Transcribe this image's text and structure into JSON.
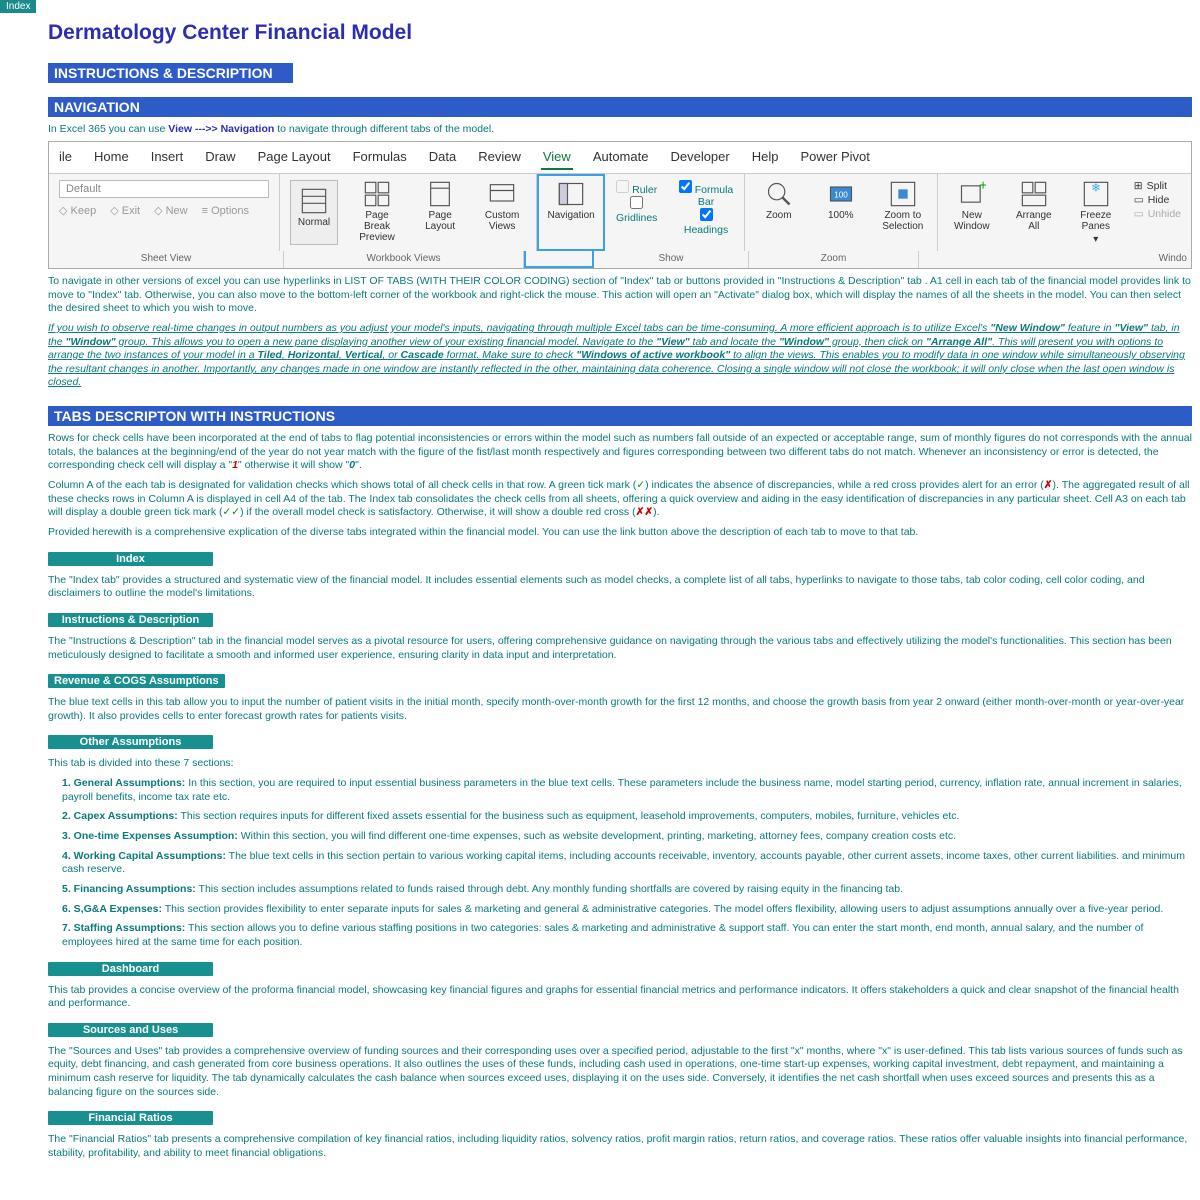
{
  "topTab": "Index",
  "mainTitle": "Dermatology Center Financial Model",
  "instructionsHdr": "INSTRUCTIONS & DESCRIPTION",
  "navHdr": "NAVIGATION",
  "navLine": {
    "p1": "In Excel 365 you can use ",
    "view": "View",
    "arrows": " --->> ",
    "nav": "Navigation",
    "p2": " to navigate through different tabs of the model."
  },
  "ribbon": {
    "tabs": [
      "ile",
      "Home",
      "Insert",
      "Draw",
      "Page Layout",
      "Formulas",
      "Data",
      "Review",
      "View",
      "Automate",
      "Developer",
      "Help",
      "Power Pivot"
    ],
    "sheetDefault": "Default",
    "sheetBtns": [
      "Keep",
      "Exit",
      "New",
      "Options"
    ],
    "wv": {
      "normal": "Normal",
      "pbp": "Page Break Preview",
      "pl": "Page Layout",
      "cv": "Custom Views"
    },
    "navBtn": "Navigation",
    "show": {
      "ruler": "Ruler",
      "formulaBar": "Formula Bar",
      "gridlines": "Gridlines",
      "headings": "Headings"
    },
    "zoom": {
      "zoom": "Zoom",
      "hundred": "100%",
      "zts": "Zoom to Selection"
    },
    "window": {
      "nw": "New Window",
      "aa": "Arrange All",
      "fp": "Freeze Panes",
      "split": "Split",
      "hide": "Hide",
      "unhide": "Unhide"
    },
    "labels": {
      "sheet": "Sheet View",
      "wb": "Workbook Views",
      "show": "Show",
      "zoom": "Zoom",
      "window": "Windo"
    }
  },
  "navPara1": "To navigate in other versions of excel you can use hyperlinks in LIST OF TABS (WITH THEIR COLOR CODING) section of \"Index\" tab or buttons provided in  \"Instructions & Description\" tab . A1 cell in each tab of the financial model provides link to move to \"Index\" tab. Otherwise, you can also move to the bottom-left corner of the workbook and right-click the mouse. This action will open an \"Activate\" dialog box, which will display the names of all the sheets in the model. You can then select the desired sheet to which you wish to move.",
  "navPara2": {
    "p1": "If you wish to observe real-time changes in output numbers as you adjust your model's inputs, navigating through multiple Excel tabs can be time-consuming. A more efficient approach is to utilize Excel's ",
    "nw": "\"New Window\"",
    "p2": " feature in ",
    "view": "\"View\"",
    "p3": " tab, in the ",
    "wgrp": "\"Window\"",
    "p4": " group. This allows you to open a new pane displaying another view of your existing financial model. Navigate to the ",
    "p5": " tab and locate the ",
    "p6": " group, then click on ",
    "aa": "\"Arrange All\"",
    "p7": ". This will present you with options to arrange the two instances of your model in a ",
    "tiled": "Tiled",
    "hor": "Horizontal",
    "ver": "Vertical",
    "or": ", or ",
    "casc": "Cascade",
    "p8": " format. Make sure to check ",
    "waw": "\"Windows of active workbook\"",
    "p9": " to align the views. This  enables you to modify data in one window while simultaneously observing the resultant changes in another. Importantly, any changes made in one window are instantly reflected in the other, maintaining data coherence. Closing a single window will not close the workbook; it will only close when the last open window is closed."
  },
  "tabsDescHdr": "TABS DESCRIPTON WITH INSTRUCTIONS",
  "tdPara1": {
    "p1": "Rows for check cells have been incorporated at the end of tabs to flag potential inconsistencies or errors within the model such as numbers fall outside of an expected or acceptable range, sum of monthly figures do not corresponds with the annual totals, the balances at the beginning/end of the year do not year match with the figure of the fist/last month respectively and figures corresponding between two different tabs do not match. Whenever an inconsistency or error is detected, the corresponding check cell will display a \"",
    "one": "1",
    "p2": "\" otherwise it will show \"",
    "zero": "0",
    "p3": "\"."
  },
  "tdPara2": {
    "p1": "Column A of the each tab is designated for validation checks which shows total of all check cells in that row. A green tick mark (",
    "tick": "✓",
    "p2": ") indicates the absence of discrepancies, while a red cross provides alert for an error (",
    "x": "✗",
    "p3": "). The aggregated result of all these checks rows in Column A is displayed in cell A4 of the tab. The Index tab consolidates the check cells from all sheets, offering a quick overview and aiding in the easy identification of discrepancies in any particular sheet. Cell A3 on each tab will display a double green tick mark (",
    "tick2": "✓✓",
    "p4": ") if the overall model check is satisfactory. Otherwise, it will show a double red cross (",
    "x2": "✗✗",
    "p5": ")."
  },
  "tdPara3": "Provided herewith is a comprehensive explication of the diverse tabs integrated within the financial model. You can use the link button above the description of each tab to move to that tab.",
  "tabs": {
    "index": {
      "hdr": "Index",
      "txt": "The \"Index tab\" provides a structured and systematic view of the financial model. It includes essential elements such as model checks, a complete list of all tabs, hyperlinks to navigate to those tabs, tab color coding, cell color coding, and disclaimers to outline the model's limitations."
    },
    "instr": {
      "hdr": "Instructions & Description",
      "txt": "The \"Instructions & Description\" tab in the financial model serves as a pivotal resource for users, offering comprehensive guidance on navigating through the various tabs and effectively utilizing the model's functionalities. This section has been meticulously designed to facilitate a smooth and informed user experience, ensuring clarity in data input and interpretation."
    },
    "rev": {
      "hdr": "Revenue & COGS Assumptions",
      "txt": "The blue text cells in this tab allow you to input the number of patient visits in the initial month, specify month-over-month growth for the first 12 months, and choose the growth basis from year 2 onward (either month-over-month or year-over-year growth). It also provides cells to enter forecast growth rates for patients visits."
    },
    "other": {
      "hdr": "Other Assumptions",
      "intro": "This tab is divided into these 7 sections:",
      "items": [
        {
          "b": "1. General Assumptions:",
          "t": " In this section, you are required to input essential business parameters in the blue text cells. These parameters include the business name, model starting period, currency, inflation rate, annual increment in salaries, payroll benefits, income tax rate etc."
        },
        {
          "b": "2. Capex Assumptions:",
          "t": " This section requires inputs for different fixed assets essential for the business such as equipment, leasehold improvements, computers, mobiles, furniture, vehicles etc."
        },
        {
          "b": "3. One-time Expenses Assumption:",
          "t": " Within this section, you will find different one-time expenses, such as website development, printing, marketing, attorney fees, company creation costs etc."
        },
        {
          "b": "4. Working Capital Assumptions:",
          "t": " The blue text cells in this section pertain to various working capital items, including accounts receivable, inventory, accounts payable, other current assets, income taxes, other current liabilities. and minimum cash reserve."
        },
        {
          "b": "5. Financing Assumptions:",
          "t": " This section includes assumptions related to funds raised through debt. Any monthly funding shortfalls are covered by raising equity in the financing tab."
        },
        {
          "b": "6. S,G&A Expenses:",
          "t": " This section provides flexibility to enter separate inputs for sales & marketing and general & administrative categories.  The model offers flexibility, allowing users to adjust assumptions annually  over a five-year period."
        },
        {
          "b": "7. Staffing Assumptions:",
          "t": " This section allows you to define various staffing positions in two categories: sales & marketing and administrative & support staff. You can enter the start month, end month, annual salary, and the number of employees hired at the same time for each position."
        }
      ]
    },
    "dash": {
      "hdr": "Dashboard",
      "txt": "This tab provides a concise overview of the proforma financial model, showcasing key financial figures and graphs for essential financial metrics and performance indicators. It offers stakeholders a quick and clear snapshot of the financial health and performance."
    },
    "su": {
      "hdr": "Sources and Uses",
      "txt": "The \"Sources and Uses\" tab provides a comprehensive overview of funding sources and their corresponding uses over a specified period, adjustable to the first \"x\" months, where \"x\" is user-defined. This tab lists various sources of funds such as equity, debt financing, and cash generated from core business operations. It also outlines the uses of these funds, including cash used in operations, one-time start-up expenses, working capital investment, debt repayment, and maintaining  a minimum cash reserve for liquidity. The tab dynamically calculates the cash balance when sources exceed uses, displaying it on the uses side. Conversely, it identifies the net cash shortfall when uses exceed sources and presents this as a balancing figure on the sources side."
    },
    "fr": {
      "hdr": "Financial Ratios",
      "txt": "The \"Financial Ratios\" tab presents a comprehensive compilation of key financial ratios, including liquidity ratios, solvency ratios, profit margin ratios, return ratios, and coverage ratios. These ratios offer valuable insights into financial performance, stability, profitability, and ability to meet financial obligations."
    }
  }
}
